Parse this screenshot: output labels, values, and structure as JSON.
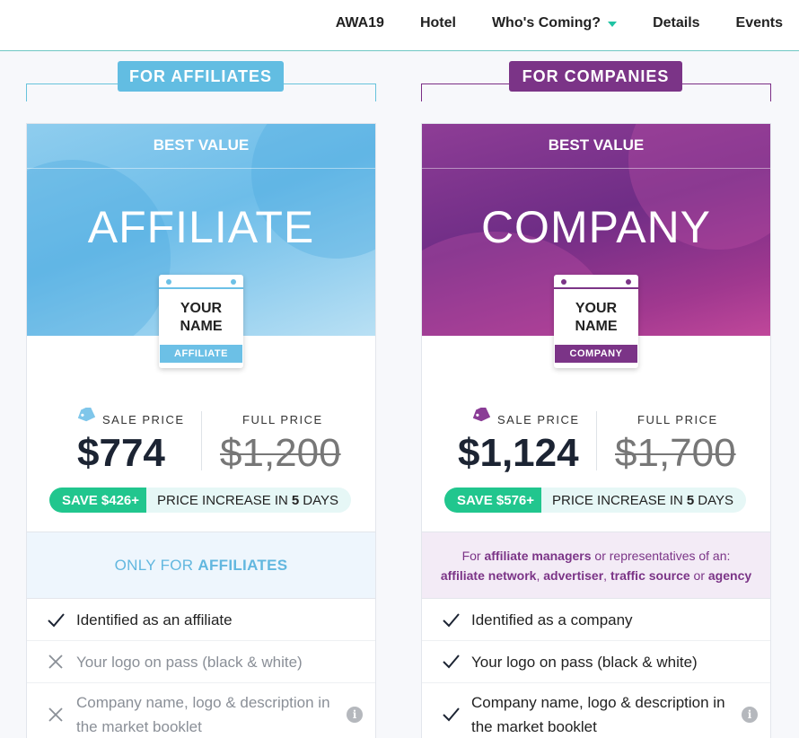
{
  "nav": {
    "items": [
      {
        "label": "AWA19"
      },
      {
        "label": "Hotel"
      },
      {
        "label": "Who's Coming?"
      },
      {
        "label": "Details"
      },
      {
        "label": "Events"
      }
    ]
  },
  "affiliate": {
    "header": "FOR AFFILIATES",
    "best": "BEST VALUE",
    "title": "AFFILIATE",
    "badge_name_line1": "YOUR",
    "badge_name_line2": "NAME",
    "badge_tag": "AFFILIATE",
    "sale_label": "SALE PRICE",
    "sale_price": "$774",
    "full_label": "FULL PRICE",
    "full_price": "$1,200",
    "save": "SAVE $426+",
    "increase_prefix": "PRICE INCREASE IN",
    "increase_days": "5",
    "increase_suffix": "DAYS",
    "only_prefix": "ONLY FOR",
    "only_bold": "AFFILIATES",
    "features": [
      {
        "text": "Identified as an affiliate",
        "included": true
      },
      {
        "text": "Your logo on pass (black & white)",
        "included": false
      },
      {
        "text": "Company name, logo & description in the market booklet",
        "included": false
      }
    ]
  },
  "company": {
    "header": "FOR COMPANIES",
    "best": "BEST VALUE",
    "title": "COMPANY",
    "badge_name_line1": "YOUR",
    "badge_name_line2": "NAME",
    "badge_tag": "COMPANY",
    "sale_label": "SALE PRICE",
    "sale_price": "$1,124",
    "full_label": "FULL PRICE",
    "full_price": "$1,700",
    "save": "SAVE $576+",
    "increase_prefix": "PRICE INCREASE IN",
    "increase_days": "5",
    "increase_suffix": "DAYS",
    "info": {
      "l1_a": "For ",
      "l1_b": "affiliate managers",
      "l1_c": " or representatives of an:",
      "l2_a": "affiliate network",
      "l2_b": ", ",
      "l2_c": "advertiser",
      "l2_d": ", ",
      "l2_e": "traffic source",
      "l2_f": " or ",
      "l2_g": "agency"
    },
    "features": [
      {
        "text": "Identified as a company",
        "included": true
      },
      {
        "text": "Your logo on pass (black & white)",
        "included": true
      },
      {
        "text": "Company name, logo & description in the market booklet",
        "included": true
      }
    ]
  },
  "colors": {
    "affiliate_accent": "#62bde2",
    "company_accent": "#7b3487",
    "save_green": "#21c68e",
    "nav_caret": "#20c3a3"
  },
  "icons": {
    "check": "check-icon",
    "cross": "cross-icon",
    "info": "info-icon",
    "sale_tag": "sale-tag-icon"
  }
}
